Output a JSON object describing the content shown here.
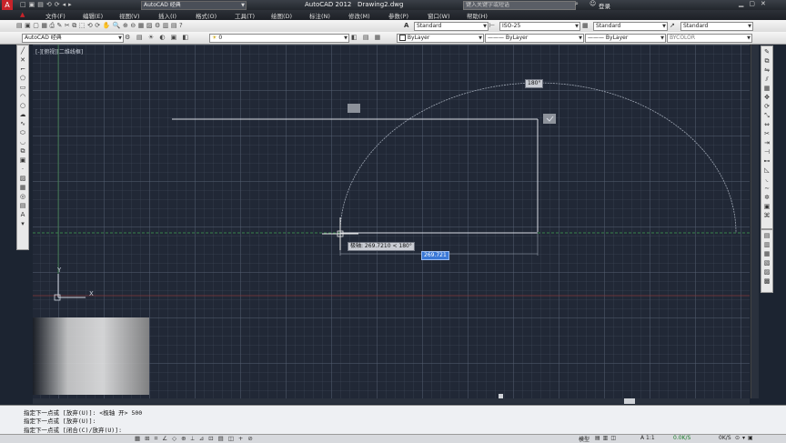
{
  "title_bar": {
    "app": "AutoCAD 2012",
    "file": "Drawing2.dwg",
    "workspace": "AutoCAD 经典",
    "search_placeholder": "键入关键字或短语",
    "login": "登录"
  },
  "menu": [
    "文件(F)",
    "编辑(E)",
    "视图(V)",
    "插入(I)",
    "格式(O)",
    "工具(T)",
    "绘图(D)",
    "标注(N)",
    "修改(M)",
    "参数(P)",
    "窗口(W)",
    "帮助(H)"
  ],
  "toolbar": {
    "workspace_combo": "AutoCAD 经典",
    "layer_combo": "0",
    "text_style": "Standard",
    "dim_style": "ISO-25",
    "table_style": "Standard",
    "multileader_style": "Standard",
    "color": "ByLayer",
    "linetype": "ByLayer",
    "lineweight": "ByLayer",
    "plotstyle": "BYCOLOR"
  },
  "viewport_label": "[-][俯视][二维线框]",
  "drawing": {
    "angle_tooltip": "180°",
    "polar_tooltip": "极轴: 269.7210 < 180°",
    "distance_input": "269.721",
    "ucs_x": "X",
    "ucs_y": "Y"
  },
  "command_history": [
    "指定下一点或 [放弃(U)]: <极轴 开> 500",
    "指定下一点或 [放弃(U)]:",
    "指定下一点或 [闭合(C)/放弃(U)]:"
  ],
  "status": {
    "model": "模型",
    "scale": "A 1:1",
    "speed": "0.0K/S",
    "ok": "0K/S"
  }
}
